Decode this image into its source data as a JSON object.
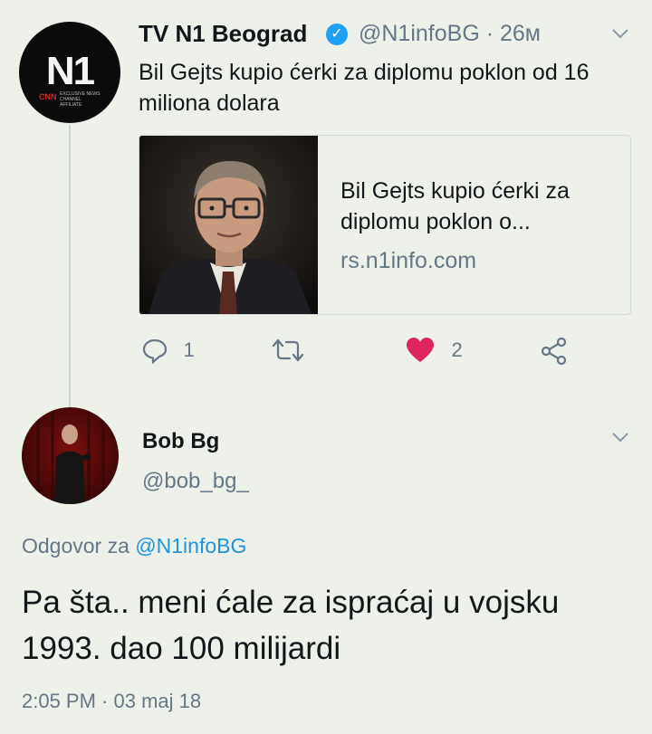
{
  "tweet": {
    "author_name": "TV N1 Beograd",
    "author_handle": "@N1infoBG",
    "separator": "·",
    "time_ago": "26м",
    "text": "Bil Gejts kupio ćerki za diplomu poklon od 16 miliona dolara",
    "avatar_logo": "N1",
    "avatar_cnn": "CNN",
    "avatar_tagline": "EXCLUSIVE NEWS CHANNEL AFFILIATE",
    "card": {
      "title": "Bil Gejts kupio ćerki za diplomu poklon o...",
      "domain": "rs.n1info.com"
    },
    "actions": {
      "reply_count": "1",
      "like_count": "2"
    }
  },
  "reply": {
    "author_name": "Bob Bg",
    "author_handle": "@bob_bg_",
    "reply_prefix": "Odgovor za",
    "reply_mention": "@N1infoBG",
    "text": "Pa šta.. meni ćale za ispraćaj u vojsku 1993. dao 100 milijardi",
    "timestamp": "2:05 PM · 03 maj 18"
  },
  "colors": {
    "background": "#eef0ea",
    "secondary_text": "#657786",
    "link": "#1b95e0",
    "like_red": "#e0245e",
    "verified_blue": "#1da1f2"
  },
  "icons": [
    "verified-badge-icon",
    "chevron-down-icon",
    "reply-icon",
    "retweet-icon",
    "heart-icon",
    "share-icon"
  ]
}
